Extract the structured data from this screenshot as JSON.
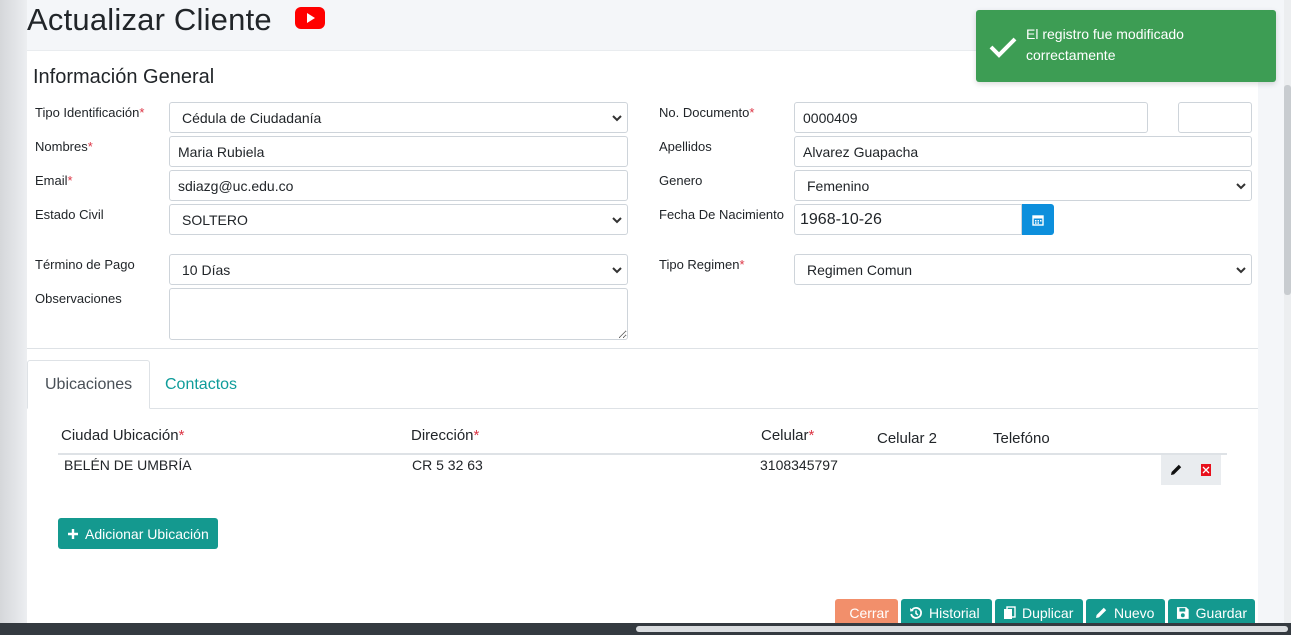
{
  "page": {
    "title": "Actualizar Cliente"
  },
  "icons": {
    "video": "youtube-icon",
    "calendar": "calendar-icon",
    "check": "check-icon"
  },
  "colors": {
    "teal": "#14998f",
    "cerrar": "#f28f6b",
    "toast": "#3d9d54",
    "calendar": "#0d8fdc",
    "required": "#dc3545"
  },
  "toast": {
    "message": "El registro fue modificado correctamente"
  },
  "form": {
    "section_title": "Información General",
    "tipo_identificacion": {
      "label": "Tipo Identificación",
      "value": "Cédula de Ciudadanía"
    },
    "no_documento": {
      "label": "No. Documento",
      "value": "0000409",
      "extra_value": ""
    },
    "nombres": {
      "label": "Nombres",
      "value": "Maria Rubiela"
    },
    "apellidos": {
      "label": "Apellidos",
      "value": "Alvarez Guapacha"
    },
    "email": {
      "label": "Email",
      "value": "sdiazg@uc.edu.co"
    },
    "genero": {
      "label": "Genero",
      "value": "Femenino"
    },
    "estado_civil": {
      "label": "Estado Civil",
      "value": "SOLTERO"
    },
    "fecha_nacimiento": {
      "label": "Fecha De Nacimiento",
      "value": "1968-10-26"
    },
    "termino_pago": {
      "label": "Término de Pago",
      "value": "10 Días"
    },
    "tipo_regimen": {
      "label": "Tipo Regimen",
      "value": "Regimen Comun"
    },
    "observaciones": {
      "label": "Observaciones",
      "value": ""
    }
  },
  "tabs": [
    {
      "label": "Ubicaciones",
      "active": true
    },
    {
      "label": "Contactos",
      "active": false
    }
  ],
  "ubicaciones": {
    "columns": {
      "ciudad": "Ciudad Ubicación",
      "direccion": "Dirección",
      "celular": "Celular",
      "celular2": "Celular 2",
      "telefono": "Telefóno"
    },
    "rows": [
      {
        "ciudad": "BELÉN DE UMBRÍA",
        "direccion": "CR 5 32 63",
        "celular": "3108345797",
        "celular2": "",
        "telefono": ""
      }
    ],
    "add_label": "Adicionar Ubicación"
  },
  "footer": {
    "cerrar": "Cerrar",
    "historial": "Historial",
    "duplicar": "Duplicar",
    "nuevo": "Nuevo",
    "guardar": "Guardar"
  }
}
